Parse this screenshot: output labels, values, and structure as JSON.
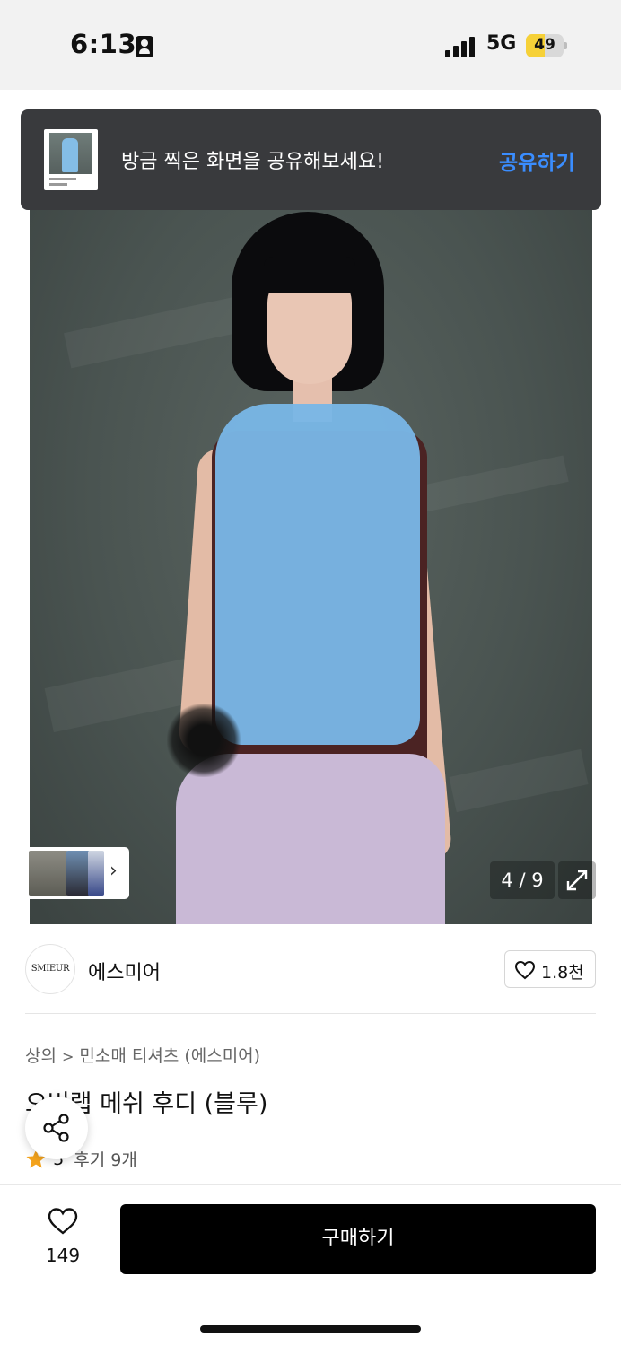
{
  "status_bar": {
    "time": "6:13",
    "network": "5G",
    "battery": "49",
    "battery_level": 0.49,
    "battery_color": "#f6d138"
  },
  "share_toast": {
    "message": "방금 찍은 화면을 공유해보세요!",
    "action_label": "공유하기",
    "action_color": "#3a8dff"
  },
  "gallery": {
    "counter": "4 / 9",
    "expand_icon": "expand-diagonal-icon",
    "thumbs_chevron": "chevron-right-icon"
  },
  "brand": {
    "logo_text": "SMIEUR",
    "name": "에스미어",
    "likes": "1.8천"
  },
  "product": {
    "breadcrumb": [
      "상의",
      "민소매 티셔츠 (에스미어)"
    ],
    "title": "오버랩 메쉬 후디 (블루)",
    "rating": "5",
    "reviews": "후기 9개",
    "star_color": "#f4a31c"
  },
  "bottom_bar": {
    "wish_count": "149",
    "buy_label": "구매하기"
  }
}
